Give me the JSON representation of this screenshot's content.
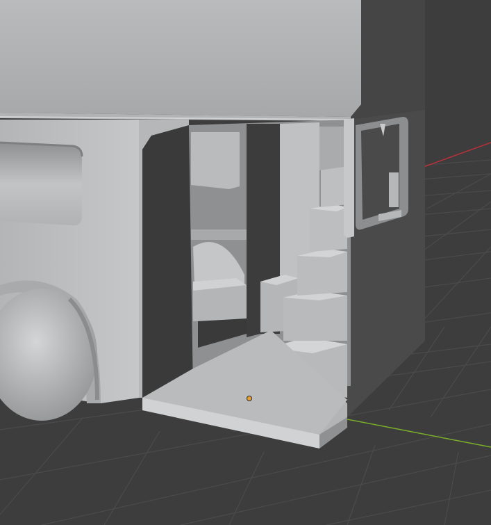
{
  "app": {
    "panel": "3D Viewport",
    "shading_mode": "solid"
  },
  "scene": {
    "object": "double-decker-bus-rear",
    "selected_origin_color": "#e8a032"
  },
  "colors": {
    "background": "#3d3d3d",
    "grid_line": "#4a4a4a",
    "axis_x": "#b8303a",
    "axis_y": "#7bb02a",
    "body_light": "#c7c9ca",
    "body_mid": "#9fa1a2",
    "body_dark": "#5f6061",
    "interior_dark": "#3a3a3b"
  }
}
